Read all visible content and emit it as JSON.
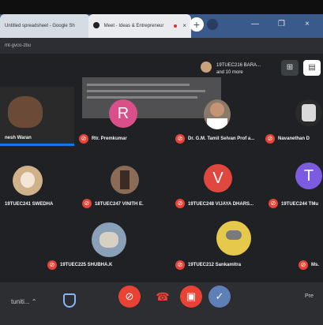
{
  "browser": {
    "tabs": [
      {
        "label": "Untitled spreadsheet - Google Sh"
      },
      {
        "label": "Meet - Ideas & Entrepreneur"
      }
    ],
    "close_symbol": "×",
    "new_tab_symbol": "+",
    "minimize_symbol": "—",
    "maximize_symbol": "❐",
    "address": "mt-gvco-zbu"
  },
  "meet": {
    "participants_summary": {
      "line1": "19TUEC216 BARA...",
      "line2": "and 10 more"
    },
    "speaker": {
      "name": "nesh Waran"
    },
    "participants": [
      {
        "name": "Rtr. Premkumar",
        "initial": "R",
        "color": "#d94f8a"
      },
      {
        "name": "Dr. G.M. Tamil Selvan Prof a...",
        "initial": "",
        "color": "#8a7a6a"
      },
      {
        "name": "Navanethan D",
        "initial": "",
        "color": "#2a2a2a"
      },
      {
        "name": "19TUEC241 SWEDHA",
        "initial": "",
        "color": "#cfb28a"
      },
      {
        "name": "18TUEC247 VINITH E.",
        "initial": "",
        "color": "#8a6b58"
      },
      {
        "name": "19TUEC248 VIJAYA DHARS...",
        "initial": "V",
        "color": "#e0473e"
      },
      {
        "name": "19TUEC244 TMu",
        "initial": "T",
        "color": "#7b5be0"
      },
      {
        "name": "19TUEC225 SHUBHA.K",
        "initial": "",
        "color": "#8a9fb8"
      },
      {
        "name": "19TUEC212 Sankamitra",
        "initial": "",
        "color": "#e6c94a"
      },
      {
        "name": "Ms.",
        "initial": "",
        "color": "#2a2a2a"
      }
    ]
  },
  "controls": {
    "left_label": "tuniti... ⌃",
    "right_label": "Pre",
    "mic_symbol": "🎙",
    "hangup_symbol": "☎",
    "present_symbol": "▣",
    "check_symbol": "✓"
  },
  "colors": {
    "mic_off": "#ea4335",
    "accent": "#1a73e8",
    "tabbar": "#3a5a8c"
  }
}
